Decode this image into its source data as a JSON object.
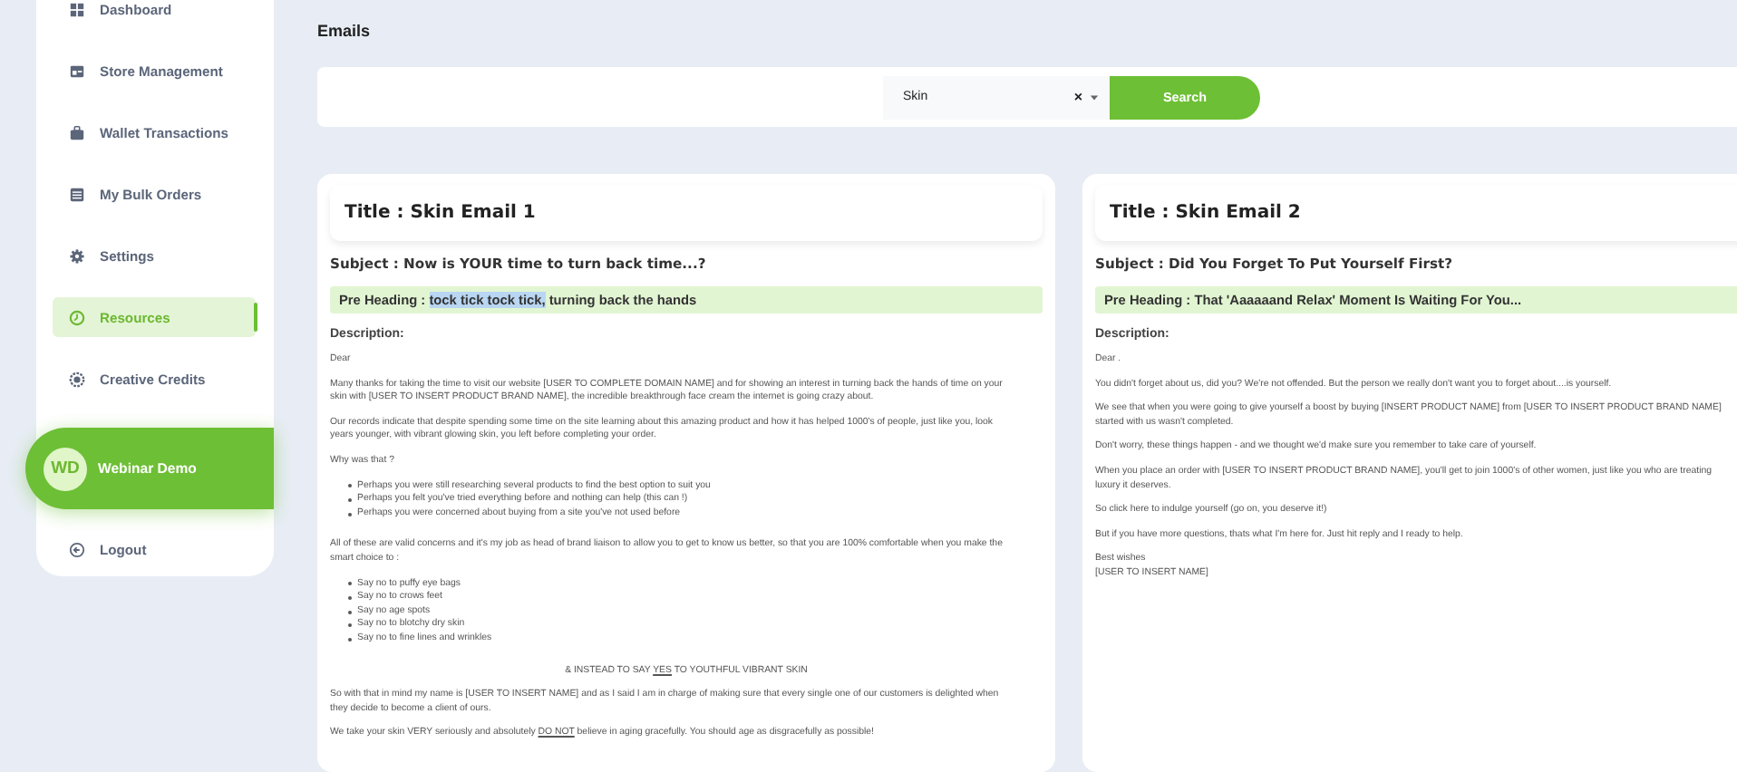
{
  "sidebar": {
    "items": [
      {
        "label": "Dashboard",
        "selected": false
      },
      {
        "label": "Store Management",
        "selected": false
      },
      {
        "label": "Wallet Transactions",
        "selected": false
      },
      {
        "label": "My Bulk Orders",
        "selected": false
      },
      {
        "label": "Settings",
        "selected": false
      },
      {
        "label": "Resources",
        "selected": true
      },
      {
        "label": "Creative Credits",
        "selected": false
      }
    ],
    "user": {
      "initials": "WD",
      "name": "Webinar Demo"
    },
    "logout": "Logout"
  },
  "page_title": "Emails",
  "search": {
    "value": "Skin",
    "clear": "×",
    "button": "Search"
  },
  "emails": [
    {
      "title": "Title : Skin Email 1",
      "subject": "Subject : Now is YOUR time to turn back time...?",
      "pre_heading": {
        "label": "Pre Heading : ",
        "highlighted": "tock tick tock tick,",
        "text": " turning back the hands"
      },
      "description_label": "Description:",
      "body": [
        {
          "kind": "para",
          "lines": [
            "Dear"
          ]
        },
        {
          "kind": "para",
          "lines": [
            "Many thanks for taking the time to visit our website [USER TO COMPLETE DOMAIN NAME] and for showing an interest in turning back the hands of time on your",
            "skin with [USER TO INSERT PRODUCT BRAND NAME],  the incredible breakthrough face cream the internet is going crazy about."
          ]
        },
        {
          "kind": "para",
          "lines": [
            "Our records indicate that despite spending some time on the site learning about this amazing product and how it has helped 1000's of people, just like you, look",
            "years younger, with vibrant glowing skin, you left before completing your order."
          ]
        },
        {
          "kind": "para",
          "lines": [
            "Why was that ?"
          ]
        },
        {
          "kind": "list",
          "items": [
            "Perhaps you were still researching several products to find the best option to suit you",
            "Perhaps you felt you've tried everything before and nothing can help (this can !)",
            "Perhaps you were concerned about buying from a site you've not used before"
          ]
        },
        {
          "kind": "para",
          "lines": [
            "All of these are valid concerns and it's my job as head of brand liaison to allow you to get to know us better, so that you are 100% comfortable when you make the",
            "smart choice to :"
          ]
        },
        {
          "kind": "list",
          "items": [
            "Say no to puffy eye bags",
            "Say no to crows feet",
            "Say no age spots",
            "Say no to blotchy dry skin",
            "Say no to fine lines and wrinkles"
          ]
        },
        {
          "kind": "centered",
          "parts": [
            {
              "text": "& INSTEAD TO SAY ",
              "underline": false
            },
            {
              "text": "YES",
              "underline": true
            },
            {
              "text": " TO YOUTHFUL VIBRANT SKIN",
              "underline": false
            }
          ]
        },
        {
          "kind": "para",
          "lines": [
            "So with that in mind my name is [USER TO INSERT NAME]  and as I said I am in charge of making sure that every single one of our customers is delighted when",
            "they decide to become a client of ours."
          ]
        },
        {
          "kind": "rich",
          "parts": [
            {
              "text": "We take your skin VERY seriously and absolutely ",
              "underline": false
            },
            {
              "text": "DO NOT",
              "underline": true
            },
            {
              "text": " believe in aging gracefully.  You should age as disgracefully as possible!",
              "underline": false
            }
          ]
        }
      ]
    },
    {
      "title": "Title : Skin Email 2",
      "subject": "Subject : Did You Forget To Put Yourself First?",
      "pre_heading": {
        "label": "Pre Heading : ",
        "text": "That 'Aaaaaand Relax' Moment Is Waiting For You..."
      },
      "description_label": "Description:",
      "body": [
        {
          "kind": "para",
          "lines": [
            "Dear  ."
          ]
        },
        {
          "kind": "para",
          "lines": [
            "You didn't forget about us, did you? We're not offended. But the person we really don't want you to forget about....is yourself."
          ]
        },
        {
          "kind": "para",
          "lines": [
            "We see that when you were going to give yourself a boost by buying [INSERT PRODUCT NAME] from [USER TO INSERT PRODUCT BRAND NAME]",
            "started with us wasn't completed."
          ]
        },
        {
          "kind": "para",
          "lines": [
            "Don't worry, these things happen - and we thought we'd make sure you remember to take care of yourself."
          ]
        },
        {
          "kind": "para",
          "lines": [
            "When you place an order with [USER TO INSERT PRODUCT BRAND NAME], you'll get to join 1000's of other women, just like you who are treating",
            "luxury it deserves."
          ]
        },
        {
          "kind": "para",
          "lines": [
            "So click here to indulge yourself (go on, you deserve it!)"
          ]
        },
        {
          "kind": "para",
          "lines": [
            "But if you have more questions, thats what I'm here for.  Just hit reply and I ready to help."
          ]
        },
        {
          "kind": "para",
          "lines": [
            "Best wishes",
            "[USER TO INSERT NAME]"
          ]
        }
      ]
    }
  ]
}
